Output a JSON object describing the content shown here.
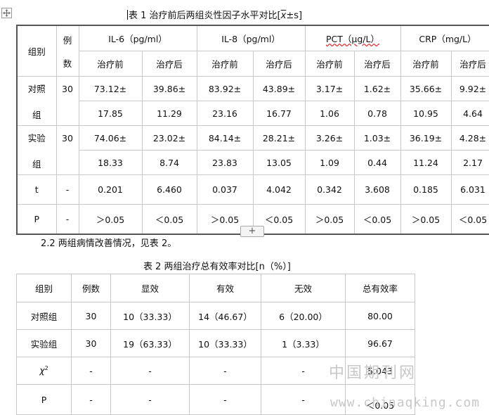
{
  "table1": {
    "caption_prefix": "表 1 治疗前后两组炎性因子水平对比[",
    "caption_mean": "x",
    "caption_suffix": "±s]",
    "headers": {
      "group": "组别",
      "count_line1": "例",
      "count_line2": "数",
      "il6": "IL-6（pg/ml）",
      "il8": "IL-8（pg/ml）",
      "pct": "PCT（μg/L）",
      "crp": "CRP（mg/L）",
      "before": "治疗前",
      "after": "治疗后"
    },
    "rows": [
      {
        "group_line1": "对照",
        "group_line2": "组",
        "n": "30",
        "v1": [
          "73.12±",
          "39.86±",
          "83.92±",
          "43.89±",
          "3.17±",
          "1.62±",
          "35.66±",
          "9.92±"
        ],
        "v2": [
          "17.85",
          "11.29",
          "23.16",
          "16.77",
          "1.06",
          "0.78",
          "10.95",
          "4.64"
        ]
      },
      {
        "group_line1": "实验",
        "group_line2": "组",
        "n": "30",
        "v1": [
          "74.06±",
          "23.02±",
          "84.14±",
          "28.21±",
          "3.26±",
          "1.03±",
          "36.19±",
          "4.28±"
        ],
        "v2": [
          "18.33",
          "8.74",
          "23.83",
          "13.05",
          "1.09",
          "0.44",
          "11.24",
          "2.17"
        ]
      }
    ],
    "t_row": {
      "label": "t",
      "n": "-",
      "values": [
        "0.201",
        "6.460",
        "0.037",
        "4.042",
        "0.342",
        "3.608",
        "0.185",
        "6.031"
      ]
    },
    "p_row": {
      "label": "P",
      "n": "-",
      "values": [
        "＞0.05",
        "＜0.05",
        "＞0.05",
        "＜0.05",
        "＞0.05",
        "＜0.05",
        "＞0.05",
        "＜0.05"
      ]
    }
  },
  "insert_button": "+",
  "paragraph": "2.2 两组病情改善情况，见表 2。",
  "table2": {
    "caption": "表 2 两组治疗总有效率对比[n（%）]",
    "headers": [
      "组别",
      "例数",
      "显效",
      "有效",
      "无效",
      "总有效率"
    ],
    "rows": [
      [
        "对照组",
        "30",
        "10（33.33）",
        "14（46.67）",
        "6（20.00）",
        "80.00"
      ],
      [
        "实验组",
        "30",
        "19（63.33）",
        "10（33.33）",
        "1（3.33）",
        "96.67"
      ]
    ],
    "chi_row": {
      "label_base": "χ",
      "label_sup": "2",
      "values": [
        "-",
        "-",
        "-",
        "-",
        "5.043"
      ]
    },
    "p_row": {
      "label": "P",
      "values": [
        "-",
        "-",
        "-",
        "-",
        "＜0.05"
      ]
    }
  },
  "watermark": {
    "line1": "中国期刊网",
    "line2": "www.chinaqking.com"
  }
}
